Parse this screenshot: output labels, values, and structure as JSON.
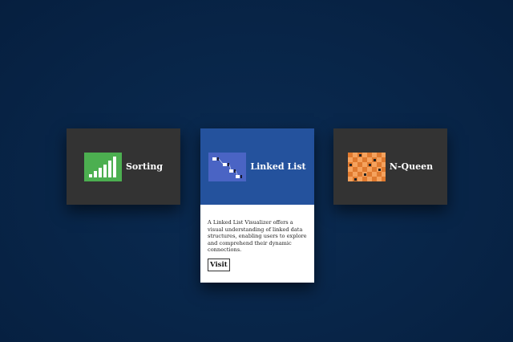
{
  "cards": [
    {
      "title": "Sorting",
      "icon": "bar-chart-icon",
      "icon_color": "#4caf50"
    },
    {
      "title": "Linked List",
      "icon": "linked-list-icon",
      "icon_color": "#4a64c4",
      "description": "A Linked List Visualizer offers a visual understanding of linked data structures, enabling users to explore and comprehend their dynamic connections.",
      "button_label": "Visit"
    },
    {
      "title": "N-Queen",
      "icon": "chessboard-icon",
      "icon_color": "#f08a3c"
    }
  ],
  "colors": {
    "background": "#082548",
    "card_dark": "#333333",
    "card_active": "#24529d",
    "text_light": "#ffffff"
  }
}
